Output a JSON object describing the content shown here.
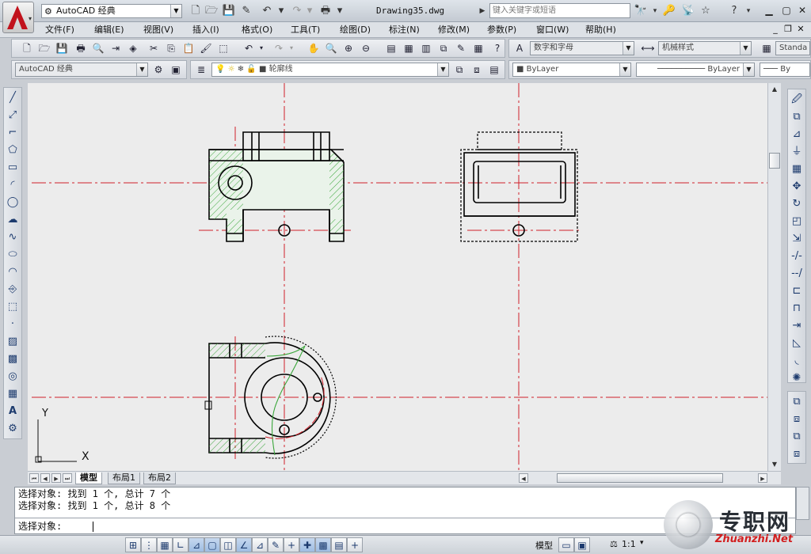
{
  "window": {
    "workspace": "AutoCAD 经典",
    "document_title": "Drawing35.dwg",
    "help_placeholder": "键入关键字或短语"
  },
  "menu": [
    "文件(F)",
    "编辑(E)",
    "视图(V)",
    "插入(I)",
    "格式(O)",
    "工具(T)",
    "绘图(D)",
    "标注(N)",
    "修改(M)",
    "参数(P)",
    "窗口(W)",
    "帮助(H)"
  ],
  "toolbars": {
    "text_style": "数字和字母",
    "dim_style": "机械样式",
    "table_style": "Standa",
    "workspace_combo": "AutoCAD 经典",
    "layer": "轮廓线",
    "color": "ByLayer",
    "linetype": "ByLayer",
    "lineweight": "By"
  },
  "ucs": {
    "x_label": "X",
    "y_label": "Y"
  },
  "tabs": [
    "模型",
    "布局1",
    "布局2"
  ],
  "command": {
    "history": [
      "选择对象: 找到 1 个, 总计 7 个",
      "选择对象: 找到 1 个, 总计 8 个"
    ],
    "prompt": "选择对象:"
  },
  "status": {
    "mode": "模型",
    "scale": "1:1"
  },
  "watermark": {
    "cn": "专职网",
    "en": "Zhuanzhi.Net"
  },
  "colors": {
    "centerline": "#d0202a",
    "hatch": "#39a63a",
    "outline": "#000000",
    "canvas": "#ececec"
  }
}
